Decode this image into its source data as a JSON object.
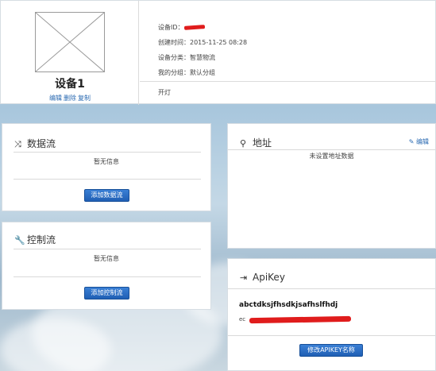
{
  "device": {
    "name": "设备1",
    "actions": {
      "edit": "编辑",
      "delete": "删除",
      "copy": "复制"
    },
    "id_label": "设备ID：",
    "created_label": "创建时间：",
    "created_value": "2015-11-25 08:28",
    "category_label": "设备分类：",
    "category_value": "智慧物流",
    "group_label": "我的分组：",
    "group_value": "默认分组",
    "switch_label": "开灯"
  },
  "datastream": {
    "title": "数据流",
    "empty_text": "暂无信息",
    "add_button": "添加数据流"
  },
  "controlstream": {
    "title": "控制流",
    "empty_text": "暂无信息",
    "add_button": "添加控制流"
  },
  "address": {
    "title": "地址",
    "edit_label": "编辑",
    "empty_text": "未设置地址数据"
  },
  "apikey": {
    "title": "ApiKey",
    "name": "abctdksjfhsdkjsafhslfhdj",
    "value_prefix": "ec",
    "rename_button": "修改APIKEY名称"
  },
  "icons": {
    "datastream": "shuffle-icon",
    "controlstream": "wrench-icon",
    "address": "map-marker-icon",
    "edit": "pencil-icon",
    "apikey": "sign-in-icon",
    "device_image": "image-placeholder-icon"
  },
  "colors": {
    "link": "#2a6ab2",
    "button": "#1f5fb4",
    "redaction": "#e01c1c"
  }
}
